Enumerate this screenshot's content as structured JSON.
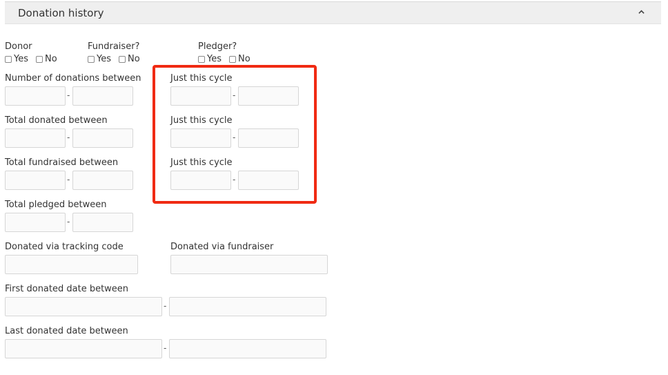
{
  "panel": {
    "title": "Donation history"
  },
  "filters": {
    "donor": {
      "label": "Donor",
      "yes": "Yes",
      "no": "No"
    },
    "fundraiser": {
      "label": "Fundraiser?",
      "yes": "Yes",
      "no": "No"
    },
    "pledger": {
      "label": "Pledger?",
      "yes": "Yes",
      "no": "No"
    }
  },
  "ranges": {
    "num_donations": "Number of donations between",
    "total_donated": "Total donated between",
    "total_fundraised": "Total fundraised between",
    "total_pledged": "Total pledged between",
    "just_this_cycle": "Just this cycle",
    "separator": "-"
  },
  "donated_via": {
    "tracking_code": "Donated via tracking code",
    "fundraiser": "Donated via fundraiser"
  },
  "dates": {
    "first_donated": "First donated date between",
    "last_donated": "Last donated date between"
  },
  "colors": {
    "highlight": "#f02a13",
    "header_bg": "#efefef"
  }
}
